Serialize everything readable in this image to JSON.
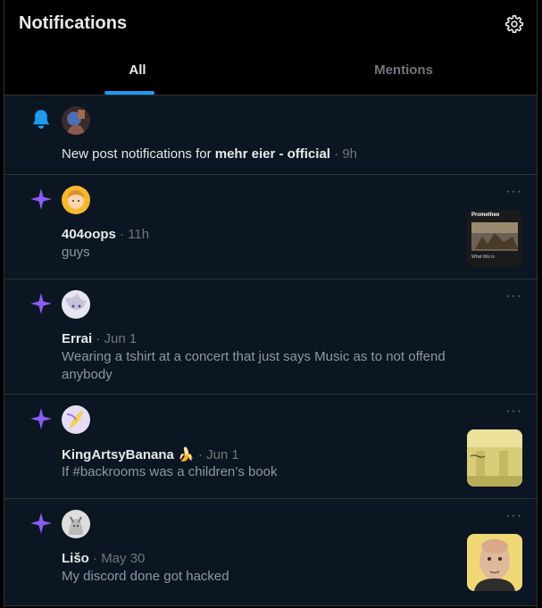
{
  "header": {
    "title": "Notifications"
  },
  "tabs": [
    {
      "label": "All"
    },
    {
      "label": "Mentions"
    }
  ],
  "items": [
    {
      "kind": "bell",
      "text_pre": "New post notifications for ",
      "text_bold": "mehr eier - official",
      "time": "9h"
    },
    {
      "kind": "star",
      "name": "404oops",
      "time": "11h",
      "body": "guys",
      "thumb_title": "Prometheo",
      "thumb_caption": "What this is"
    },
    {
      "kind": "star",
      "name": "Errai",
      "time": "Jun 1",
      "body": "Wearing a tshirt at a concert that just says Music as to not offend anybody"
    },
    {
      "kind": "star",
      "name": "KingArtsyBanana",
      "emoji": "🍌",
      "time": "Jun 1",
      "body": "If #backrooms was a children’s book"
    },
    {
      "kind": "star",
      "name": "Lišo",
      "time": "May 30",
      "body": "My discord done got hacked"
    }
  ],
  "separator": "·",
  "more_label": "···",
  "colors": {
    "accent": "#1d9bf0",
    "star": "#8b5cf6",
    "bg": "#0b1622"
  }
}
